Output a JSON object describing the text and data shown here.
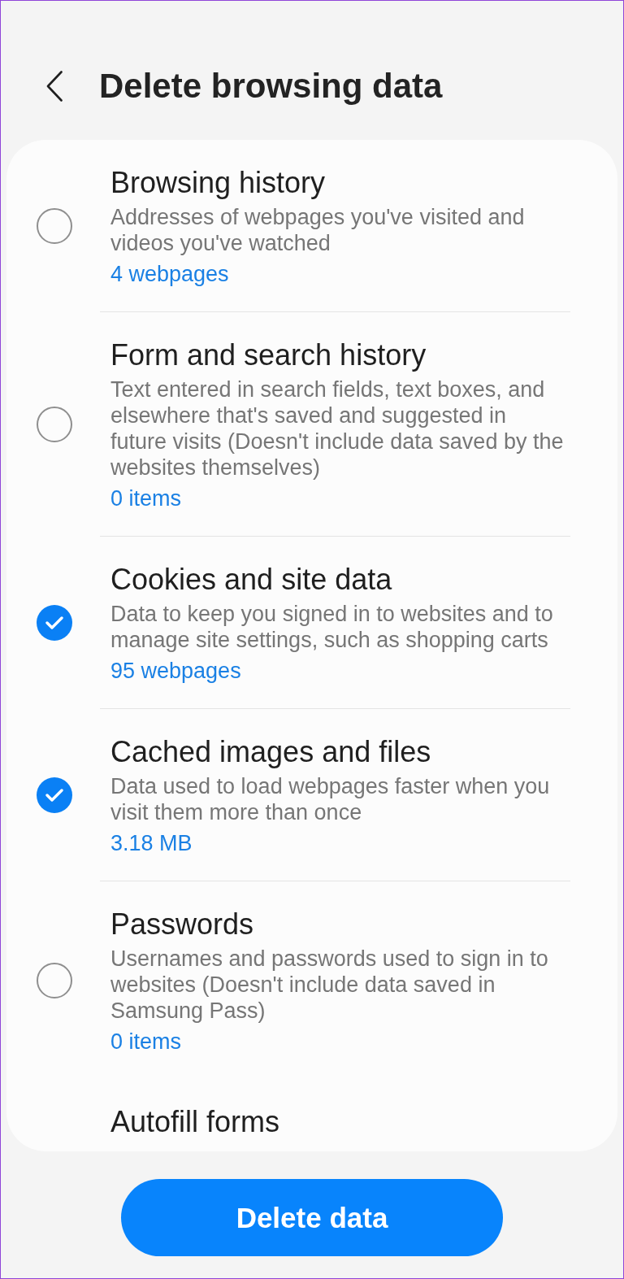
{
  "header": {
    "title": "Delete browsing data"
  },
  "items": [
    {
      "title": "Browsing history",
      "description": "Addresses of webpages you've visited and videos you've watched",
      "count": "4 webpages",
      "checked": false
    },
    {
      "title": "Form and search history",
      "description": "Text entered in search fields, text boxes, and elsewhere that's saved and suggested in future visits (Doesn't include data saved by the websites themselves)",
      "count": "0 items",
      "checked": false
    },
    {
      "title": "Cookies and site data",
      "description": "Data to keep you signed in to websites and to manage site settings, such as shopping carts",
      "count": "95 webpages",
      "checked": true
    },
    {
      "title": "Cached images and files",
      "description": "Data used to load webpages faster when you visit them more than once",
      "count": "3.18 MB",
      "checked": true
    },
    {
      "title": "Passwords",
      "description": "Usernames and passwords used to sign in to websites (Doesn't include data saved in Samsung Pass)",
      "count": "0 items",
      "checked": false
    },
    {
      "title": "Autofill forms"
    }
  ],
  "button": {
    "label": "Delete data"
  }
}
